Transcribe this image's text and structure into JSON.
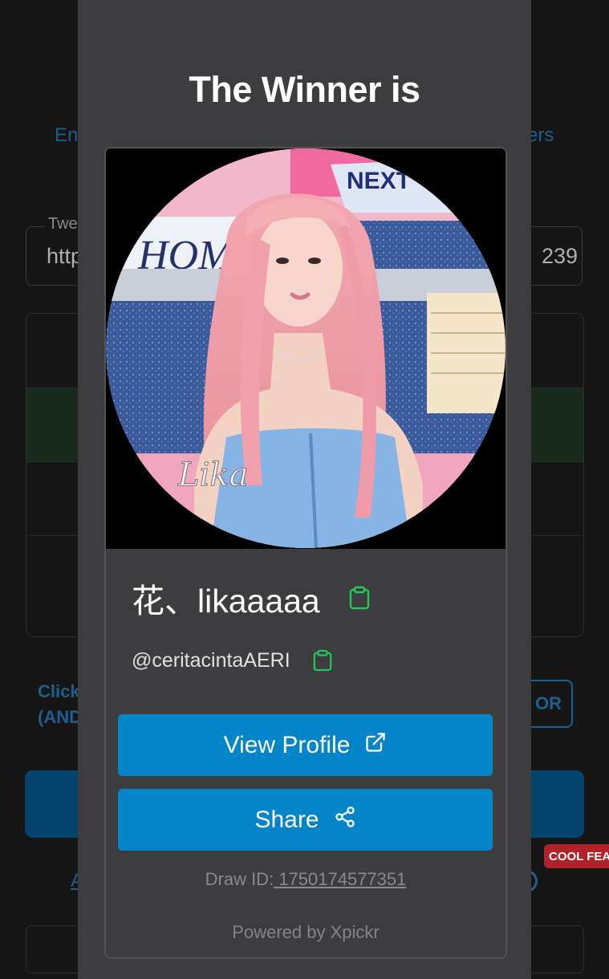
{
  "background": {
    "link_left": "En",
    "link_right": "ers",
    "input_label": "Twe",
    "input_value_start": "http",
    "input_value_end": "239",
    "click_text_line1": "Click",
    "click_text_line2": "(AND",
    "or_label": "OR",
    "badge": "COOL FEA",
    "link_a": "A"
  },
  "modal": {
    "title": "The Winner is",
    "winner": {
      "display_name": "花、likaaaaa",
      "handle": "@ceritacintaAERI",
      "photo_watermark": "Lika",
      "photo_sign_text": "HOM",
      "photo_banner_text": "NEXT"
    },
    "view_profile_label": "View Profile",
    "share_label": "Share",
    "draw_id_label": "Draw ID:",
    "draw_id_value": " 1750174577351",
    "powered_by": "Powered by Xpickr"
  },
  "colors": {
    "accent": "#0585c9",
    "copy_icon": "#22c55e",
    "modal_bg": "#3d3d3f",
    "page_bg": "#161617"
  },
  "icons": {
    "copy": "clipboard-icon",
    "external": "external-link-icon",
    "share": "share-icon"
  }
}
